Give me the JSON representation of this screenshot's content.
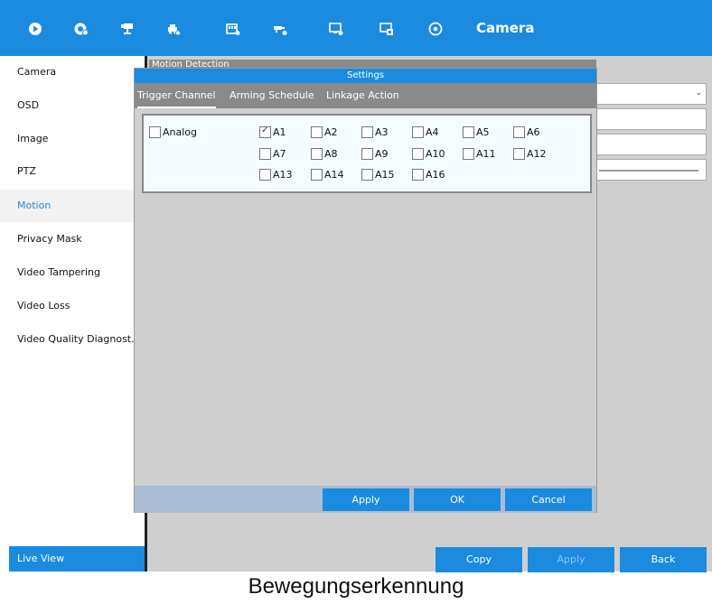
{
  "topbar": {
    "icons": [
      "playback-icon",
      "record-settings-icon",
      "camera-management-icon",
      "vehicle-icon",
      "storage-icon",
      "network-icon",
      "system-icon",
      "maintenance-icon",
      "shutdown-icon"
    ],
    "title": "Camera"
  },
  "sidebar": {
    "items": [
      {
        "label": "Camera"
      },
      {
        "label": "OSD"
      },
      {
        "label": "Image"
      },
      {
        "label": "PTZ"
      },
      {
        "label": "Motion",
        "active": true
      },
      {
        "label": "Privacy Mask"
      },
      {
        "label": "Video Tampering"
      },
      {
        "label": "Video Loss"
      },
      {
        "label": "Video Quality Diagnost..."
      }
    ],
    "live_view": "Live View"
  },
  "background_page": {
    "section_title": "Motion Detection",
    "buttons": {
      "copy": "Copy",
      "apply": "Apply",
      "back": "Back"
    }
  },
  "dialog": {
    "title": "Settings",
    "tabs": [
      "Trigger Channel",
      "Arming Schedule",
      "Linkage Action"
    ],
    "active_tab": "Trigger Channel",
    "analog_label": "Analog",
    "analog_checked": false,
    "channels": [
      {
        "label": "A1",
        "checked": true
      },
      {
        "label": "A2",
        "checked": false
      },
      {
        "label": "A3",
        "checked": false
      },
      {
        "label": "A4",
        "checked": false
      },
      {
        "label": "A5",
        "checked": false
      },
      {
        "label": "A6",
        "checked": false
      },
      {
        "label": "A7",
        "checked": false
      },
      {
        "label": "A8",
        "checked": false
      },
      {
        "label": "A9",
        "checked": false
      },
      {
        "label": "A10",
        "checked": false
      },
      {
        "label": "A11",
        "checked": false
      },
      {
        "label": "A12",
        "checked": false
      },
      {
        "label": "A13",
        "checked": false
      },
      {
        "label": "A14",
        "checked": false
      },
      {
        "label": "A15",
        "checked": false
      },
      {
        "label": "A16",
        "checked": false
      }
    ],
    "buttons": {
      "apply": "Apply",
      "ok": "OK",
      "cancel": "Cancel"
    }
  },
  "caption": "Bewegungserkennung",
  "colors": {
    "accent": "#1b8be0",
    "panel": "#cfcfcf",
    "tab_bar": "#8a8a8a"
  }
}
